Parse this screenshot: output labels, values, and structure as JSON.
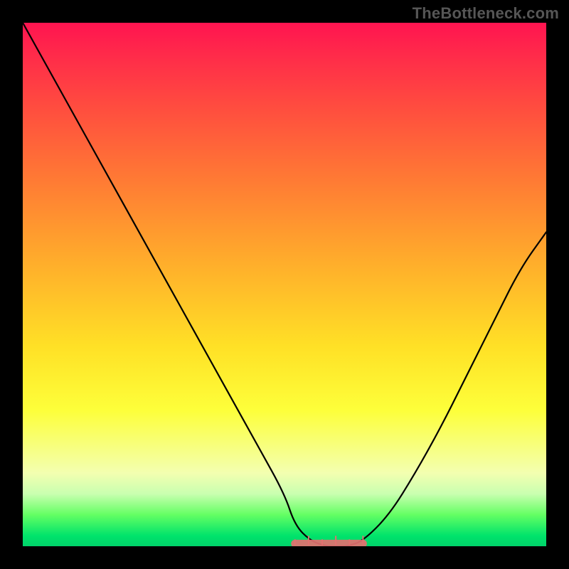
{
  "attribution": "TheBottleneck.com",
  "colors": {
    "flat_segment": "#e27070",
    "curve": "#000000",
    "frame": "#000000"
  },
  "chart_data": {
    "type": "line",
    "title": "",
    "xlabel": "",
    "ylabel": "",
    "xlim": [
      0,
      100
    ],
    "ylim": [
      0,
      100
    ],
    "series": [
      {
        "name": "bottleneck-curve",
        "x": [
          0,
          5,
          10,
          15,
          20,
          25,
          30,
          35,
          40,
          45,
          50,
          52,
          55,
          58,
          60,
          62,
          65,
          70,
          75,
          80,
          85,
          90,
          95,
          100
        ],
        "y": [
          100,
          91,
          82,
          73,
          64,
          55,
          46,
          37,
          28,
          19,
          10,
          4,
          1,
          0,
          0,
          0,
          1,
          6,
          14,
          23,
          33,
          43,
          53,
          60
        ]
      }
    ],
    "flat_segment": {
      "x_start": 52,
      "x_end": 65,
      "y": 0.5
    },
    "annotations": []
  }
}
